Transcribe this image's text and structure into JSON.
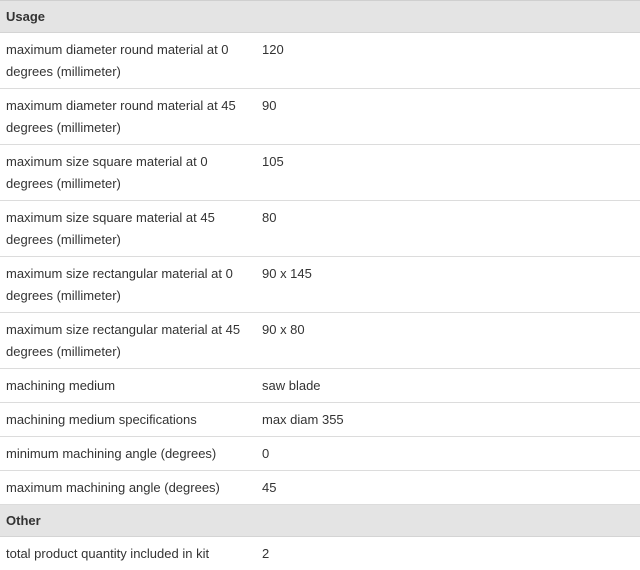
{
  "sections": [
    {
      "title": "Usage",
      "rows": [
        {
          "label": "maximum diameter round material at 0 degrees (millimeter)",
          "value": "120"
        },
        {
          "label": "maximum diameter round material at 45 degrees (millimeter)",
          "value": "90"
        },
        {
          "label": "maximum size square material at 0 degrees (millimeter)",
          "value": "105"
        },
        {
          "label": "maximum size square material at 45 degrees (millimeter)",
          "value": "80"
        },
        {
          "label": "maximum size rectangular material at 0 degrees (millimeter)",
          "value": "90 x 145"
        },
        {
          "label": "maximum size rectangular material at 45 degrees (millimeter)",
          "value": "90 x 80"
        },
        {
          "label": "machining medium",
          "value": "saw blade"
        },
        {
          "label": "machining medium specifications",
          "value": "max diam 355"
        },
        {
          "label": "minimum machining angle (degrees)",
          "value": "0"
        },
        {
          "label": "maximum machining angle (degrees)",
          "value": "45"
        }
      ]
    },
    {
      "title": "Other",
      "rows": [
        {
          "label": "total product quantity included in kit",
          "value": "2"
        }
      ]
    }
  ]
}
